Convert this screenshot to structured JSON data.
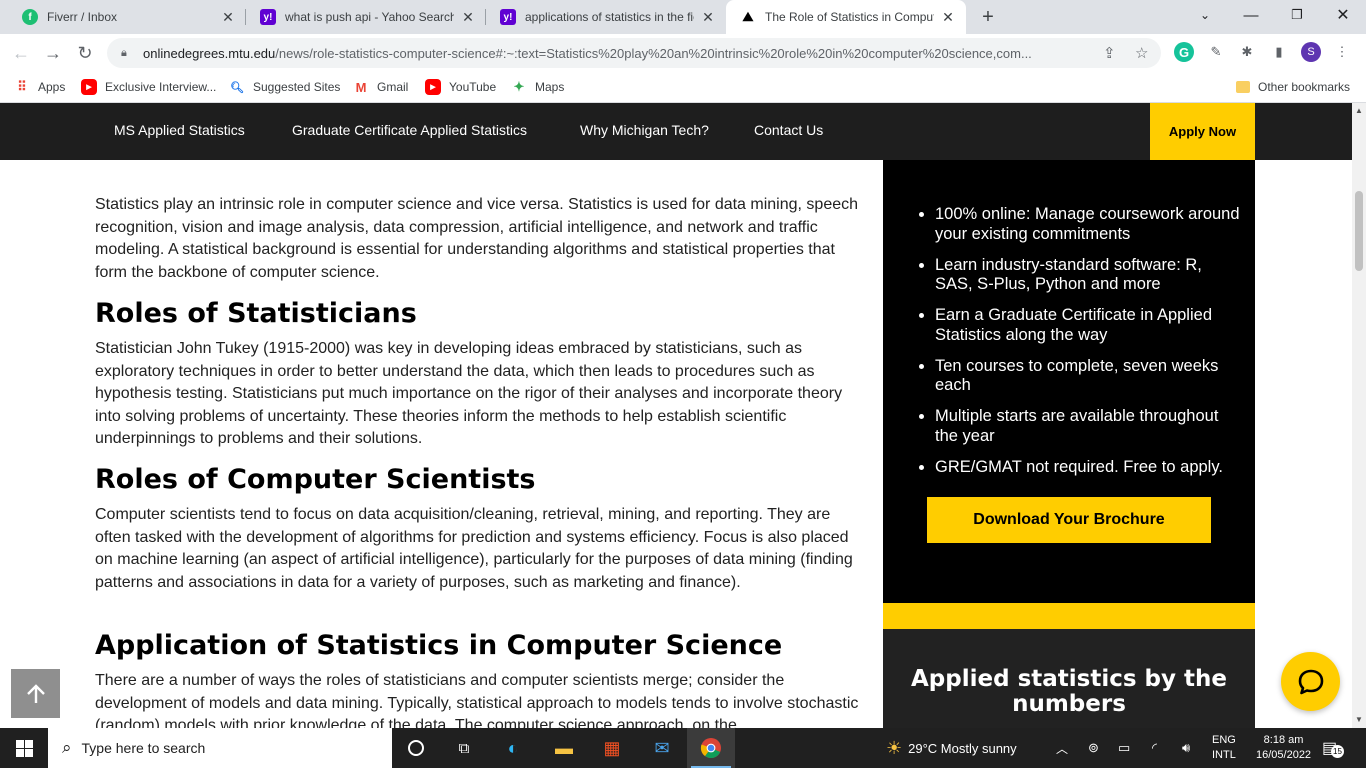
{
  "browser": {
    "tabs": [
      {
        "title": "Fiverr / Inbox",
        "favicon": "fiverr-icon",
        "active": false
      },
      {
        "title": "what is push api - Yahoo Search R",
        "favicon": "yahoo-icon",
        "active": false
      },
      {
        "title": "applications of statistics in the fie",
        "favicon": "yahoo-icon",
        "active": false
      },
      {
        "title": "The Role of Statistics in Compute",
        "favicon": "mtu-icon",
        "active": true
      }
    ],
    "url_host": "onlinedegrees.mtu.edu",
    "url_path": "/news/role-statistics-computer-science#:~:text=Statistics%20play%20an%20intrinsic%20role%20in%20computer%20science,com...",
    "profile_initial": "S",
    "bookmarks": [
      "Apps",
      "Exclusive Interview...",
      "Suggested Sites",
      "Gmail",
      "YouTube",
      "Maps"
    ],
    "other_bookmarks": "Other bookmarks"
  },
  "site": {
    "nav": [
      "MS Applied Statistics",
      "Graduate Certificate Applied Statistics",
      "Why Michigan Tech?",
      "Contact Us"
    ],
    "apply_label": "Apply Now"
  },
  "article": {
    "intro": "Statistics play an intrinsic role in computer science and vice versa. Statistics is used for data mining, speech recognition, vision and image analysis, data compression, artificial intelligence, and network and traffic modeling. A statistical background is essential for understanding algorithms and statistical properties that form the backbone of computer science.",
    "sections": [
      {
        "heading": "Roles of Statisticians",
        "body": "Statistician John Tukey (1915-2000) was key in developing ideas embraced by statisticians, such as exploratory techniques in order to better understand the data, which then leads to procedures such as hypothesis testing. Statisticians put much importance on the rigor of their analyses and incorporate theory into solving problems of uncertainty. These theories inform the methods to help establish scientific underpinnings to problems and their solutions."
      },
      {
        "heading": "Roles of Computer Scientists",
        "body": "Computer scientists tend to focus on data acquisition/cleaning, retrieval, mining, and reporting. They are often tasked with the development of algorithms for prediction and systems efficiency. Focus is also placed on machine learning (an aspect of artificial intelligence), particularly for the purposes of data mining (finding patterns and associations in data for a variety of purposes, such as marketing and finance)."
      },
      {
        "heading": "Application of Statistics in Computer Science",
        "body": "There are a number of ways the roles of statisticians and computer scientists merge; consider the development of models and data mining. Typically, statistical approach to models tends to involve stochastic (random) models with prior knowledge of the data. The computer science approach, on the"
      }
    ]
  },
  "sidebar": {
    "features": [
      "100% online: Manage coursework around your existing commitments",
      "Learn industry-standard software: R, SAS, S-Plus, Python and more",
      "Earn a Graduate Certificate in Applied Statistics along the way",
      "Ten courses to complete, seven weeks each",
      "Multiple starts are available throughout the year",
      "GRE/GMAT not required. Free to apply."
    ],
    "brochure_label": "Download Your Brochure",
    "stats_title": "Applied statistics by the numbers"
  },
  "taskbar": {
    "search_placeholder": "Type here to search",
    "weather": "29°C  Mostly sunny",
    "lang_top": "ENG",
    "lang_bottom": "INTL",
    "time": "8:18 am",
    "date": "16/05/2022",
    "notifications": "15"
  },
  "colors": {
    "brand_yellow": "#ffcd00",
    "nav_dark": "#1e1e1e"
  }
}
